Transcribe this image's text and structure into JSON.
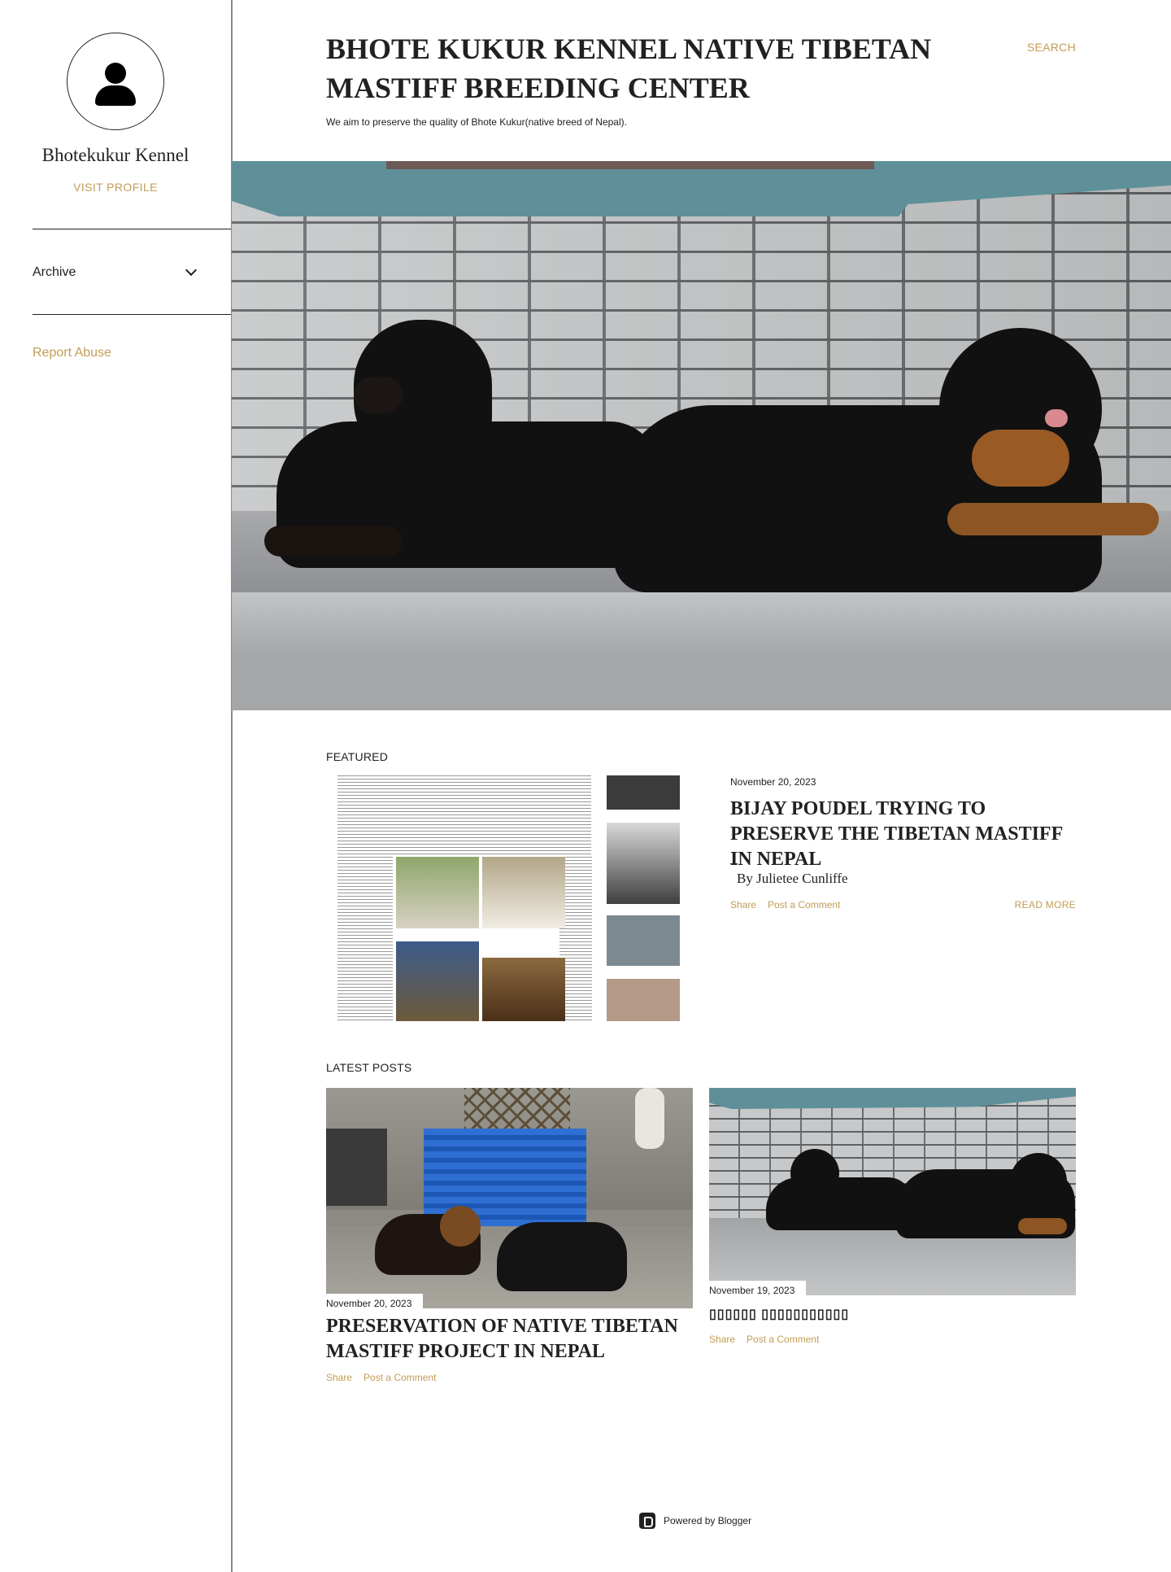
{
  "sidebar": {
    "profile_name": "Bhotekukur Kennel",
    "visit_profile": "VISIT PROFILE",
    "archive": "Archive",
    "report_abuse": "Report Abuse"
  },
  "header": {
    "title": "BHOTE KUKUR KENNEL NATIVE TIBETAN MASTIFF BREEDING CENTER",
    "description": "We aim to preserve the quality of Bhote Kukur(native breed of Nepal).",
    "search": "SEARCH"
  },
  "featured": {
    "label": "FEATURED",
    "date": "November 20, 2023",
    "title": "BIJAY POUDEL TRYING TO PRESERVE THE TIBETAN MASTIFF IN NEPAL",
    "dash": "–",
    "byline": "By Julietee Cunliffe",
    "share": "Share",
    "comment": "Post a Comment",
    "read_more": "READ MORE"
  },
  "latest": {
    "label": "LATEST POSTS",
    "posts": [
      {
        "date": "November 20, 2023",
        "title": "PRESERVATION OF NATIVE TIBETAN MASTIFF PROJECT IN NEPAL",
        "share": "Share",
        "comment": "Post a Comment"
      },
      {
        "date": "November 19, 2023",
        "title": "▯▯▯▯▯▯ ▯▯▯▯▯▯▯▯▯▯▯",
        "share": "Share",
        "comment": "Post a Comment"
      }
    ]
  },
  "footer": {
    "powered_by": "Powered by Blogger"
  },
  "colors": {
    "accent": "#c39c56",
    "text": "#212121"
  }
}
